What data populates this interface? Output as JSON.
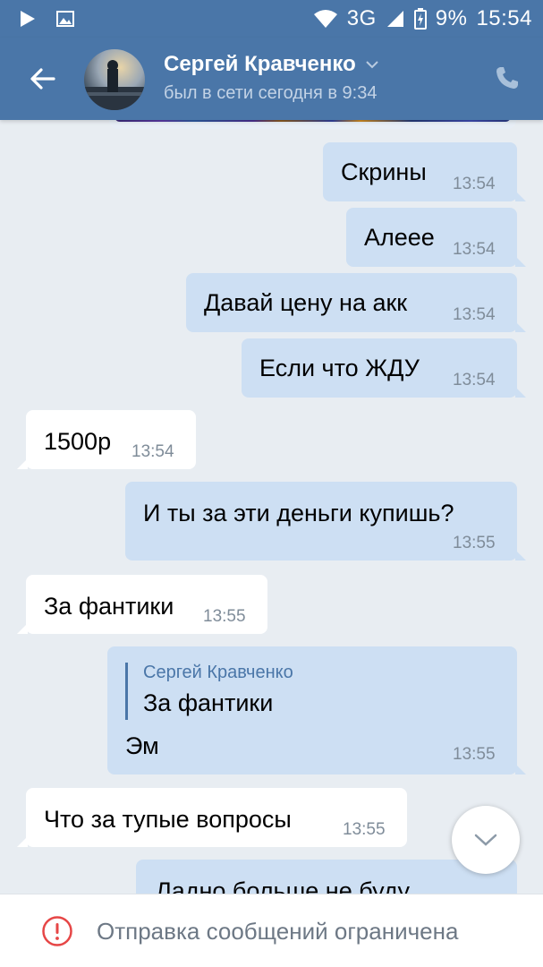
{
  "status_bar": {
    "network": "3G",
    "battery": "9%",
    "time": "15:54"
  },
  "header": {
    "contact_name": "Сергей Кравченко",
    "last_seen": "был в сети сегодня в 9:34",
    "back_icon": "arrow-left-icon",
    "call_icon": "phone-icon"
  },
  "messages": [
    {
      "direction": "out",
      "text": "Скрины",
      "time": "13:54"
    },
    {
      "direction": "out",
      "text": "Алеее",
      "time": "13:54"
    },
    {
      "direction": "out",
      "text": "Давай цену на акк",
      "time": "13:54"
    },
    {
      "direction": "out",
      "text": "Если что ЖДУ",
      "time": "13:54"
    },
    {
      "direction": "in",
      "text": "1500р",
      "time": "13:54"
    },
    {
      "direction": "out",
      "text": "И ты за эти деньги купишь?",
      "time": "13:55"
    },
    {
      "direction": "in",
      "text": "За фантики",
      "time": "13:55"
    },
    {
      "direction": "out",
      "reply_to_name": "Сергей Кравченко",
      "reply_to_text": "За фантики",
      "text": "Эм",
      "time": "13:55"
    },
    {
      "direction": "in",
      "text": "Что за тупые вопросы",
      "time": "13:55"
    },
    {
      "direction": "out",
      "text": "Ладно больше не буду",
      "time": ""
    }
  ],
  "composer": {
    "restriction_text": "Отправка сообщений ограничена"
  },
  "colors": {
    "header": "#4a76a8",
    "outgoing_bubble": "#cddff3",
    "incoming_bubble": "#ffffff",
    "chat_bg": "#e8edf2",
    "warning": "#e64646"
  }
}
